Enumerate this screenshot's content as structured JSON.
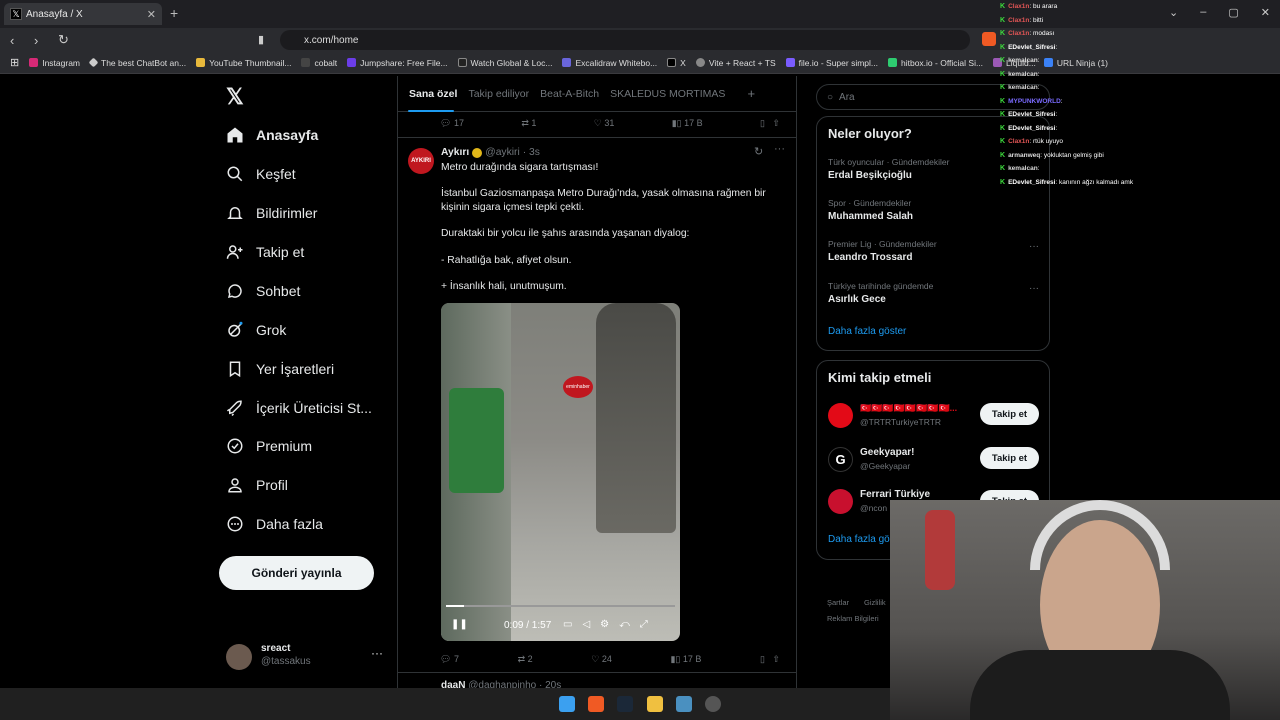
{
  "browser": {
    "tab_title": "Anasayfa / X",
    "url": "x.com/home",
    "bookmarks": [
      "Instagram",
      "The best ChatBot an...",
      "YouTube Thumbnail...",
      "cobalt",
      "Jumpshare: Free File...",
      "Watch Global & Loc...",
      "Excalidraw Whitebo...",
      "X",
      "Vite + React + TS",
      "file.io - Super simpl...",
      "hitbox.io - Official Si...",
      "Liquid..."
    ],
    "url_ninja": "URL Ninja (1)"
  },
  "nav": {
    "items": [
      "Anasayfa",
      "Keşfet",
      "Bildirimler",
      "Takip et",
      "Sohbet",
      "Grok",
      "Yer İşaretleri",
      "İçerik Üreticisi St...",
      "Premium",
      "Profil",
      "Daha fazla"
    ],
    "post_button": "Gönderi yayınla",
    "account_name": "sreact",
    "account_handle": "@tassakus"
  },
  "timeline": {
    "tabs": [
      "Sana özel",
      "Takip ediliyor",
      "Beat-A-Bitch",
      "SKALEDUS MORTIMAS"
    ],
    "prev_actions": {
      "replies": "17",
      "reposts": "1",
      "likes": "31",
      "views": "17 B"
    },
    "tweet": {
      "author": "Aykırı",
      "handle": "@aykiri",
      "time": "· 3s",
      "avatar_text": "AYKIRI",
      "lines": [
        "Metro durağında sigara tartışması!",
        "İstanbul Gaziosmanpaşa Metro Durağı'nda, yasak olmasına rağmen bir",
        "kişinin sigara içmesi tepki çekti.",
        "Duraktaki bir yolcu ile şahıs arasında yaşanan diyalog:",
        "- Rahatlığa bak, afiyet olsun.",
        "+ İnsanlık hali, unutmuşum."
      ],
      "video_time": "0:09 / 1:57",
      "video_progress": 0.08,
      "watermark": "eminhaber",
      "actions": {
        "replies": "7",
        "reposts": "2",
        "likes": "24",
        "views": "17 B"
      }
    },
    "next_author": "daaN",
    "next_handle": "@daghanpinho · 20s"
  },
  "right": {
    "search_placeholder": "Ara",
    "trends_title": "Neler oluyor?",
    "trends": [
      {
        "context": "Türk oyuncular · Gündemdekiler",
        "name": "Erdal Beşikçioğlu"
      },
      {
        "context": "Spor · Gündemdekiler",
        "name": "Muhammed Salah"
      },
      {
        "context": "Premier Lig · Gündemdekiler",
        "name": "Leandro Trossard"
      },
      {
        "context": "Türkiye tarihinde gündemde",
        "name": "Asırlık Gece"
      }
    ],
    "show_more": "Daha fazla göster",
    "follow_title": "Kimi takip etmeli",
    "follow": [
      {
        "name": "🇹🇷🇹🇷🇹🇷🇹🇷🇹🇷🇹🇷🇹🇷🇹🇷...",
        "handle": "@TRTRTurkiyeTRTR",
        "btn": "Takip et"
      },
      {
        "name": "Geekyapar!",
        "handle": "@Geekyapar",
        "btn": "Takip et"
      },
      {
        "name": "Ferrari Türkiye",
        "handle": "@ncon",
        "btn": "Takip et"
      }
    ],
    "follow_more": "Daha fazla gö",
    "footer1": "Şartlar",
    "footer2": "Gizlilik",
    "footer3": "Reklam Bilgileri"
  },
  "chat": [
    {
      "user": "Clax1n",
      "msg": "bu arara",
      "color": "#e05555"
    },
    {
      "user": "Clax1n",
      "msg": "bitti",
      "color": "#e05555"
    },
    {
      "user": "Clax1n",
      "msg": "modası",
      "color": "#e05555"
    },
    {
      "user": "EDevlet_Sifresi",
      "msg": "",
      "color": "#ffffff"
    },
    {
      "user": "kemalcan",
      "msg": "",
      "color": "#dddddd"
    },
    {
      "user": "kemalcan",
      "msg": "",
      "color": "#dddddd"
    },
    {
      "user": "kemalcan",
      "msg": "",
      "color": "#dddddd"
    },
    {
      "user": "MYPUNKWORLD",
      "msg": "",
      "color": "#7a6bff"
    },
    {
      "user": "EDevlet_Sifresi",
      "msg": "",
      "color": "#ffffff"
    },
    {
      "user": "EDevlet_Sifresi",
      "msg": "",
      "color": "#ffffff"
    },
    {
      "user": "Clax1n",
      "msg": "rtük uyuyo",
      "color": "#e05555"
    },
    {
      "user": "armanweq",
      "msg": "yokluktan gelmiş gibi",
      "color": "#dddddd"
    },
    {
      "user": "kemalcan",
      "msg": "",
      "color": "#dddddd"
    },
    {
      "user": "EDevlet_Sifresi",
      "msg": "kanının ağzı kalmadı amk",
      "color": "#ffffff"
    }
  ]
}
